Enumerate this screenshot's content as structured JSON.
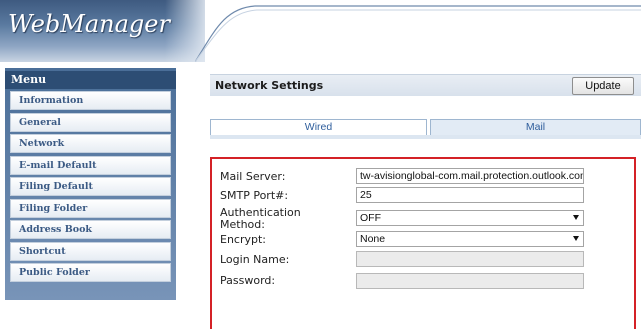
{
  "app": {
    "logo_text": "WebManager"
  },
  "menu": {
    "title": "Menu",
    "items": [
      {
        "label": "Information"
      },
      {
        "label": "General"
      },
      {
        "label": "Network"
      },
      {
        "label": "E-mail Default"
      },
      {
        "label": "Filing Default"
      },
      {
        "label": "Filing Folder"
      },
      {
        "label": "Address Book"
      },
      {
        "label": "Shortcut"
      },
      {
        "label": "Public Folder"
      }
    ]
  },
  "settings": {
    "title": "Network Settings",
    "update_label": "Update"
  },
  "tabs": [
    {
      "label": "Wired",
      "selected": false
    },
    {
      "label": "Mail",
      "selected": true
    }
  ],
  "form": {
    "mail_server": {
      "label": "Mail Server:",
      "value": "tw-avisionglobal-com.mail.protection.outlook.com"
    },
    "smtp_port": {
      "label": "SMTP Port#:",
      "value": "25"
    },
    "auth_method": {
      "label_line1": "Authentication",
      "label_line2": "Method:",
      "value": "OFF"
    },
    "encrypt": {
      "label": "Encrypt:",
      "value": "None"
    },
    "login_name": {
      "label": "Login Name:",
      "value": ""
    },
    "password": {
      "label": "Password:",
      "value": ""
    }
  },
  "colors": {
    "highlight_border": "#d42126",
    "menu_bg": "#4a6e98",
    "tab_text": "#2f5e9c"
  }
}
